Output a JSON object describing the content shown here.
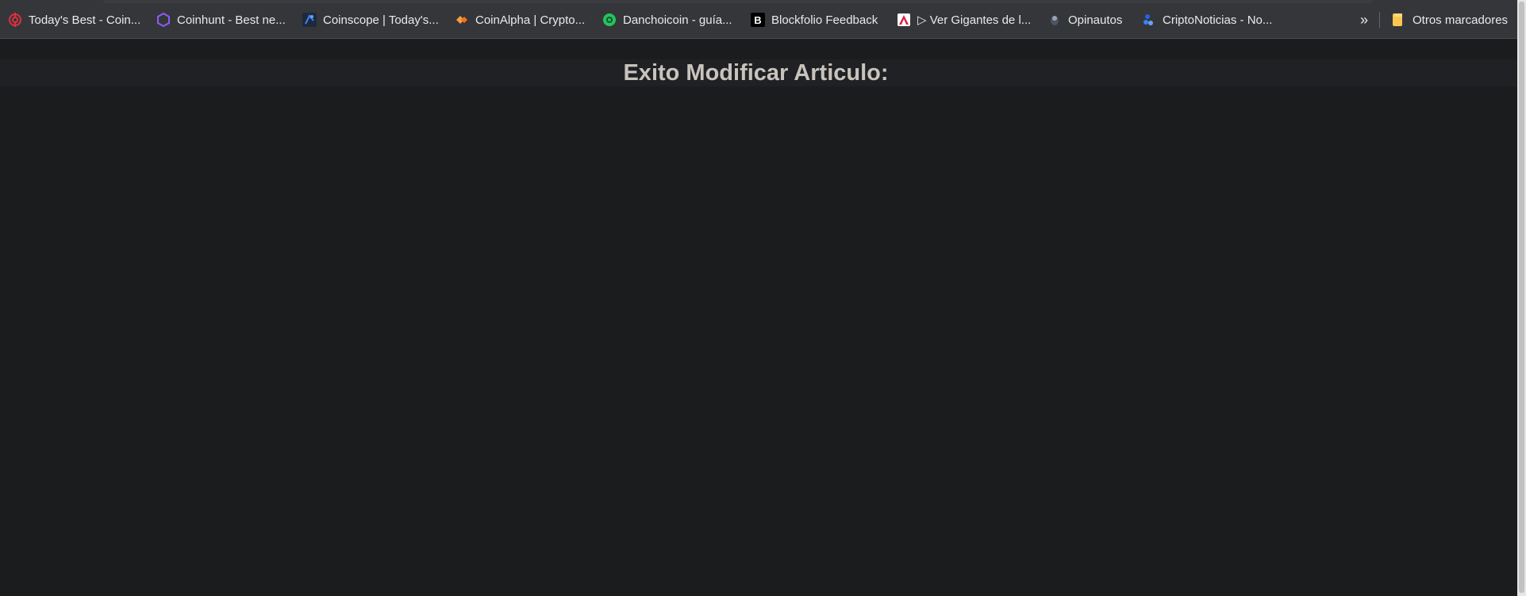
{
  "bookmarks": [
    {
      "label": "Today's Best - Coin...",
      "icon": "target-icon",
      "color": "#e0303f"
    },
    {
      "label": "Coinhunt - Best ne...",
      "icon": "hexagon-icon",
      "color": "#8b5cf6"
    },
    {
      "label": "Coinscope | Today's...",
      "icon": "coinscope-icon",
      "color": "#3b82f6"
    },
    {
      "label": "CoinAlpha | Crypto...",
      "icon": "diamond-icon",
      "color": "#f59e42"
    },
    {
      "label": "Danchoicoin - guía...",
      "icon": "globe-icon",
      "color": "#22c55e"
    },
    {
      "label": "Blockfolio Feedback",
      "icon": "letter-b-icon",
      "color": "#000000"
    },
    {
      "label": "▷ Ver Gigantes de l...",
      "icon": "flag-icon",
      "color": "#e11d48"
    },
    {
      "label": "Opinautos",
      "icon": "cat-icon",
      "color": "#6b7280"
    },
    {
      "label": "CriptoNoticias - No...",
      "icon": "cube-icon",
      "color": "#2563eb"
    }
  ],
  "overflow_label": "»",
  "other_bookmarks": {
    "label": "Otros marcadores",
    "icon": "folder-icon",
    "color": "#f9c74f"
  },
  "page": {
    "title": "Exito Modificar Articulo:"
  },
  "colors": {
    "toolbar_bg": "#35363a",
    "page_bg": "#1b1c1e",
    "title_band_bg": "#202124",
    "title_text": "#c8c3bc"
  }
}
